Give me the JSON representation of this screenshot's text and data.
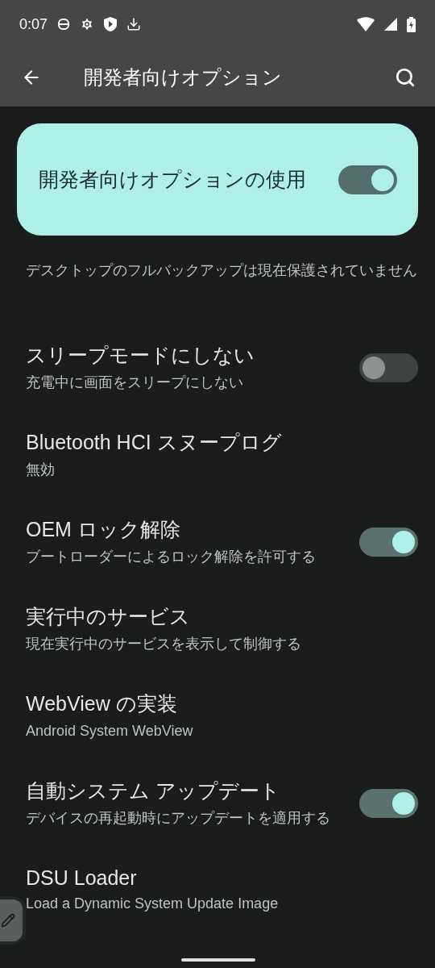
{
  "status_bar": {
    "time": "0:07"
  },
  "toolbar": {
    "title": "開発者向けオプション"
  },
  "main_switch": {
    "label": "開発者向けオプションの使用",
    "on": true
  },
  "settings": [
    {
      "kind": "plain",
      "subtitle": "デスクトップのフルバックアップは現在保護されていません"
    },
    {
      "kind": "switch",
      "title": "スリープモードにしない",
      "subtitle": "充電中に画面をスリープにしない",
      "on": false
    },
    {
      "kind": "plain",
      "title": "Bluetooth HCI スヌープログ",
      "subtitle": "無効"
    },
    {
      "kind": "switch",
      "title": "OEM ロック解除",
      "subtitle": "ブートローダーによるロック解除を許可する",
      "on": true
    },
    {
      "kind": "plain",
      "title": "実行中のサービス",
      "subtitle": "現在実行中のサービスを表示して制御する"
    },
    {
      "kind": "plain",
      "title": "WebView の実装",
      "subtitle": "Android System WebView"
    },
    {
      "kind": "switch",
      "title": "自動システム アップデート",
      "subtitle": "デバイスの再起動時にアップデートを適用する",
      "on": true
    },
    {
      "kind": "plain",
      "title": "DSU Loader",
      "subtitle": "Load a Dynamic System Update Image"
    }
  ]
}
